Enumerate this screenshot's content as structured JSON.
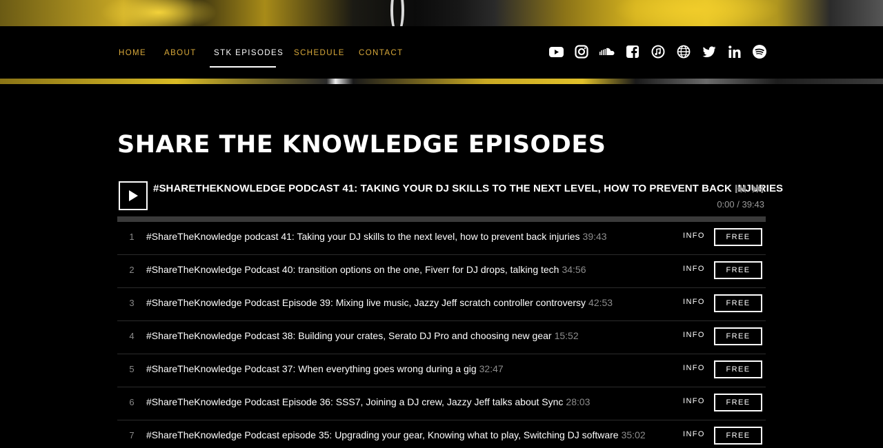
{
  "nav": {
    "items": [
      {
        "label": "HOME",
        "active": false
      },
      {
        "label": "ABOUT",
        "active": false
      },
      {
        "label": "STK EPISODES",
        "active": true
      },
      {
        "label": "SCHEDULE",
        "active": false
      },
      {
        "label": "CONTACT",
        "active": false
      }
    ],
    "social_icons": [
      "youtube-icon",
      "instagram-icon",
      "soundcloud-icon",
      "facebook-icon",
      "apple-music-icon",
      "website-globe-icon",
      "twitter-icon",
      "linkedin-icon",
      "spotify-icon"
    ],
    "accent_color": "#d9a93a"
  },
  "page": {
    "title": "SHARE THE KNOWLEDGE EPISODES"
  },
  "player": {
    "now_playing": "#SHARETHEKNOWLEDGE PODCAST 41: TAKING YOUR DJ SKILLS TO THE NEXT LEVEL, HOW TO PREVENT BACK INJURIES",
    "time": "0:00 / 39:43",
    "progress": 0
  },
  "tracks": [
    {
      "num": "1",
      "title": "#ShareTheKnowledge podcast 41: Taking your DJ skills to the next level, how to prevent back injuries",
      "duration": "39:43",
      "info_label": "INFO",
      "price_label": "FREE"
    },
    {
      "num": "2",
      "title": "#ShareTheKnowledge Podcast 40: transition options on the one, Fiverr for DJ drops, talking tech",
      "duration": "34:56",
      "info_label": "INFO",
      "price_label": "FREE"
    },
    {
      "num": "3",
      "title": "#ShareTheKnowledge Podcast Episode 39: Mixing live music, Jazzy Jeff scratch controller controversy",
      "duration": "42:53",
      "info_label": "INFO",
      "price_label": "FREE"
    },
    {
      "num": "4",
      "title": "#ShareTheKnowledge Podcast 38: Building your crates, Serato DJ Pro and choosing new gear",
      "duration": "15:52",
      "info_label": "INFO",
      "price_label": "FREE"
    },
    {
      "num": "5",
      "title": "#ShareTheKnowledge Podcast 37: When everything goes wrong during a gig",
      "duration": "32:47",
      "info_label": "INFO",
      "price_label": "FREE"
    },
    {
      "num": "6",
      "title": "#ShareTheKnowledge Podcast Episode 36: SSS7, Joining a DJ crew, Jazzy Jeff talks about Sync",
      "duration": "28:03",
      "info_label": "INFO",
      "price_label": "FREE"
    },
    {
      "num": "7",
      "title": "#ShareTheKnowledge Podcast episode 35: Upgrading your gear, Knowing what to play, Switching DJ software",
      "duration": "35:02",
      "info_label": "INFO",
      "price_label": "FREE"
    }
  ]
}
